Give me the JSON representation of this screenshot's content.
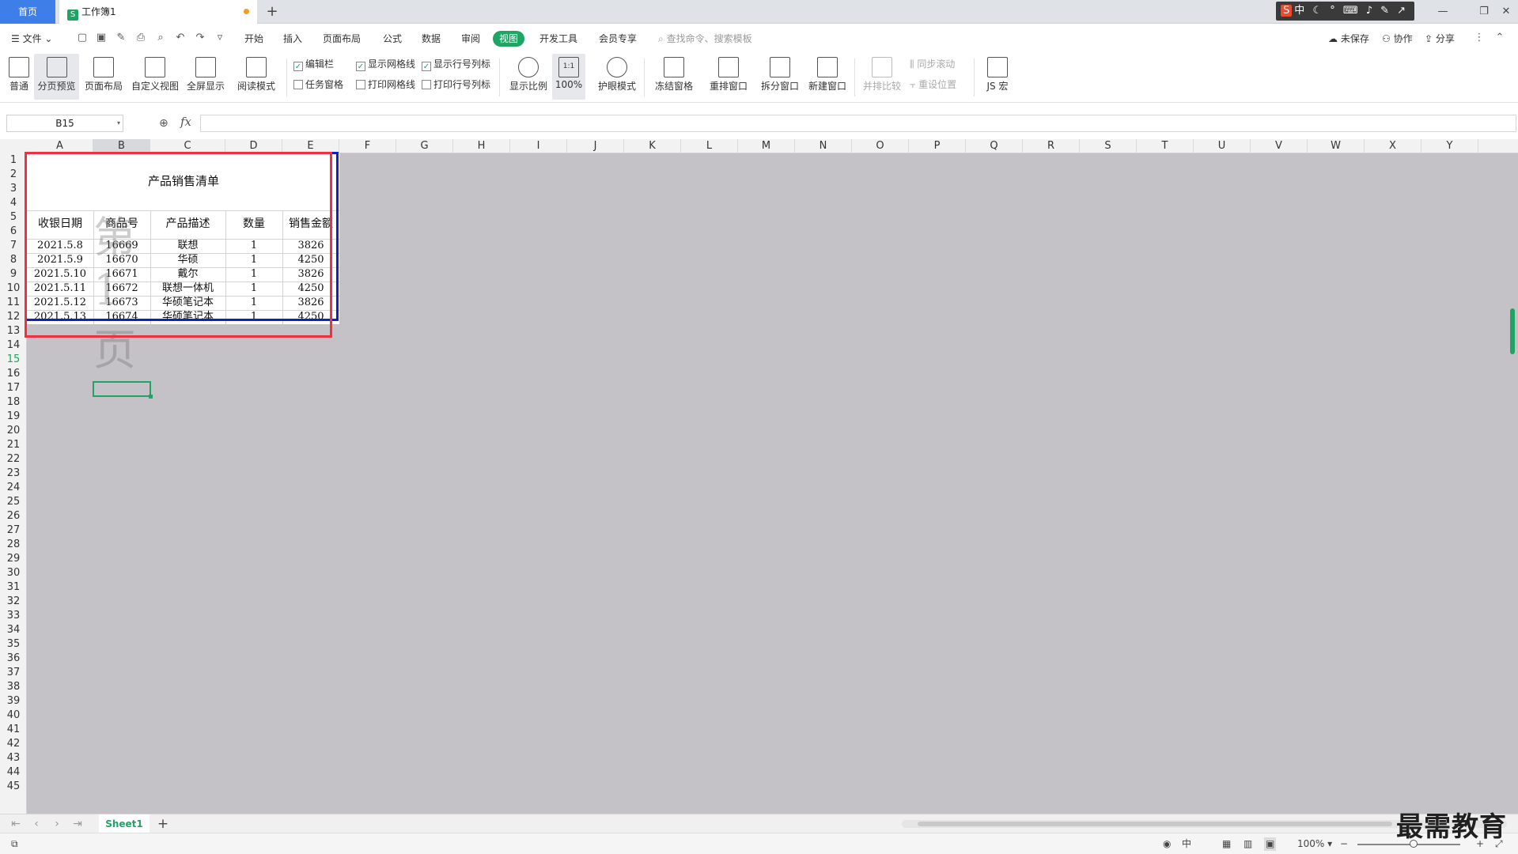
{
  "tabs": {
    "home": "首页",
    "document": "工作簿1",
    "doc_badge": "S"
  },
  "ime": {
    "label": "中"
  },
  "menu": {
    "file": "文件",
    "items": [
      "开始",
      "插入",
      "页面布局",
      "公式",
      "数据",
      "审阅",
      "视图",
      "开发工具",
      "会员专享"
    ],
    "active": "视图",
    "search_placeholder": "查找命令、搜索模板",
    "unsaved": "未保存",
    "collaborate": "协作",
    "share": "分享"
  },
  "ribbon": {
    "normal": "普通",
    "page_break_preview": "分页预览",
    "page_layout": "页面布局",
    "custom_view": "自定义视图",
    "full_screen": "全屏显示",
    "reading_mode": "阅读模式",
    "formula_bar_check": "编辑栏",
    "task_pane_check": "任务窗格",
    "show_gridlines": "显示网格线",
    "print_gridlines": "打印网格线",
    "show_headings": "显示行号列标",
    "print_headings": "打印行号列标",
    "zoom": "显示比例",
    "zoom_100": "100%",
    "zoom_100_icon": "1:1",
    "eye_mode": "护眼模式",
    "freeze_panes": "冻结窗格",
    "arrange": "重排窗口",
    "split": "拆分窗口",
    "new_window": "新建窗口",
    "side_by_side": "并排比较",
    "sync_scroll": "同步滚动",
    "reset_position": "重设位置",
    "macro": "JS 宏"
  },
  "formula": {
    "name_box": "B15",
    "fx": "fx",
    "value": ""
  },
  "columns": [
    "A",
    "B",
    "C",
    "D",
    "E",
    "F",
    "G",
    "H",
    "I",
    "J",
    "K",
    "L",
    "M",
    "N",
    "O",
    "P",
    "Q",
    "R",
    "S",
    "T",
    "U",
    "V",
    "W",
    "X",
    "Y"
  ],
  "selected_column": "B",
  "selected_row": "15",
  "sheet": {
    "title": "产品销售清单",
    "headers": [
      "收银日期",
      "商品号",
      "产品描述",
      "数量",
      "销售金额"
    ],
    "rows": [
      [
        "2021.5.8",
        "16669",
        "联想",
        "1",
        "3826"
      ],
      [
        "2021.5.9",
        "16670",
        "华硕",
        "1",
        "4250"
      ],
      [
        "2021.5.10",
        "16671",
        "戴尔",
        "1",
        "3826"
      ],
      [
        "2021.5.11",
        "16672",
        "联想一体机",
        "1",
        "4250"
      ],
      [
        "2021.5.12",
        "16673",
        "华硕笔记本",
        "1",
        "3826"
      ],
      [
        "2021.5.13",
        "16674",
        "华硕笔记本",
        "1",
        "4250"
      ]
    ],
    "watermark": "第1页"
  },
  "sheet_tabs": {
    "active": "Sheet1",
    "add": "+"
  },
  "status": {
    "zoom": "100%"
  },
  "brand": "最需教育",
  "colors": {
    "accent": "#1fa463",
    "home_tab": "#3d7ee8",
    "print_area": "#1020c8",
    "annotation": "#f03040"
  }
}
